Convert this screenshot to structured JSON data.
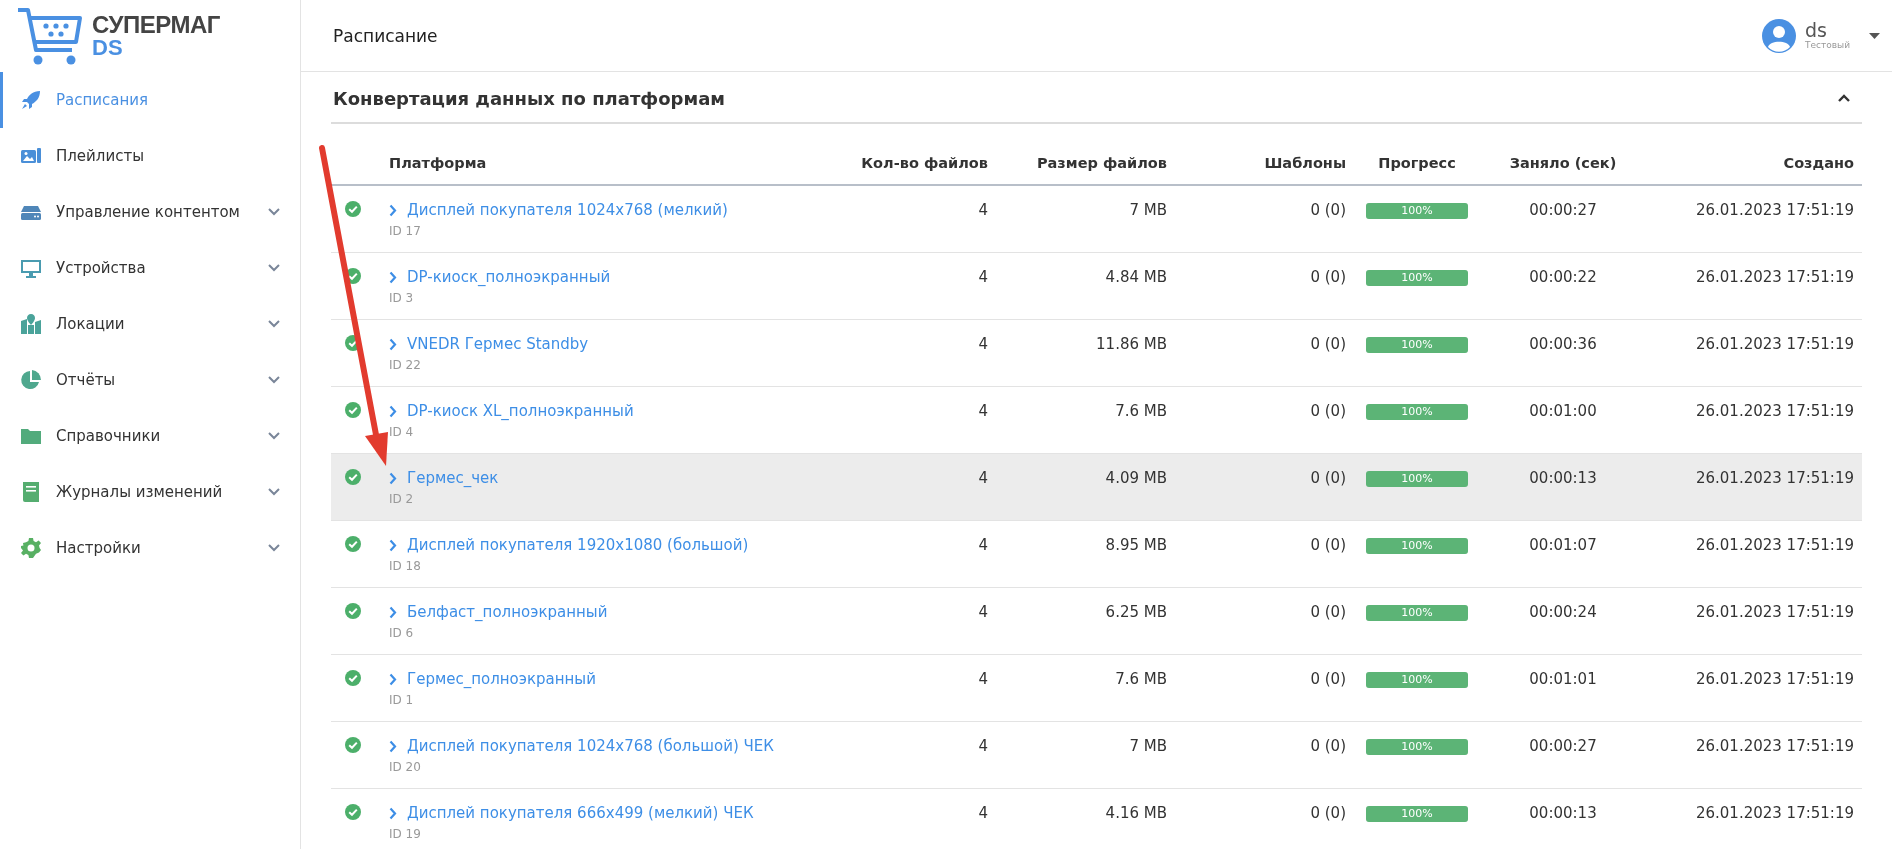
{
  "logo": {
    "line1": "СУПЕРМАГ",
    "line2": "DS"
  },
  "sidebar": {
    "items": [
      {
        "label": "Расписания",
        "selected": true,
        "expandable": false
      },
      {
        "label": "Плейлисты",
        "selected": false,
        "expandable": false
      },
      {
        "label": "Управление контентом",
        "selected": false,
        "expandable": true
      },
      {
        "label": "Устройства",
        "selected": false,
        "expandable": true
      },
      {
        "label": "Локации",
        "selected": false,
        "expandable": true
      },
      {
        "label": "Отчёты",
        "selected": false,
        "expandable": true
      },
      {
        "label": "Справочники",
        "selected": false,
        "expandable": true
      },
      {
        "label": "Журналы изменений",
        "selected": false,
        "expandable": true
      },
      {
        "label": "Настройки",
        "selected": false,
        "expandable": true
      }
    ]
  },
  "header": {
    "title": "Расписание",
    "user": {
      "name": "ds",
      "role": "Тестовый"
    }
  },
  "section": {
    "title": "Конвертация данных по платформам",
    "expanded": true
  },
  "table": {
    "columns": [
      "Платформа",
      "Кол-во файлов",
      "Размер файлов",
      "Шаблоны",
      "Прогресс",
      "Заняло (сек)",
      "Создано"
    ],
    "rows": [
      {
        "platform": "Дисплей покупателя 1024x768 (мелкий)",
        "id": "ID 17",
        "files": "4",
        "size": "7 MB",
        "templates": "0 (0)",
        "progress": "100%",
        "level": 1,
        "duration": "00:00:27",
        "created": "26.01.2023 17:51:19",
        "selected": false
      },
      {
        "platform": "DP-киоск_полноэкранный",
        "id": "ID 3",
        "files": "4",
        "size": "4.84 MB",
        "templates": "0 (0)",
        "progress": "100%",
        "level": 1,
        "duration": "00:00:22",
        "created": "26.01.2023 17:51:19",
        "selected": false
      },
      {
        "platform": "VNEDR Гермес Standby",
        "id": "ID 22",
        "files": "4",
        "size": "11.86 MB",
        "templates": "0 (0)",
        "progress": "100%",
        "level": 1,
        "duration": "00:00:36",
        "created": "26.01.2023 17:51:19",
        "selected": false
      },
      {
        "platform": "DP-киоск XL_полноэкранный",
        "id": "ID 4",
        "files": "4",
        "size": "7.6 MB",
        "templates": "0 (0)",
        "progress": "100%",
        "level": 1,
        "duration": "00:01:00",
        "created": "26.01.2023 17:51:19",
        "selected": false
      },
      {
        "platform": "Гермес_чек",
        "id": "ID 2",
        "files": "4",
        "size": "4.09 MB",
        "templates": "0 (0)",
        "progress": "100%",
        "level": 1,
        "duration": "00:00:13",
        "created": "26.01.2023 17:51:19",
        "selected": true
      },
      {
        "platform": "Дисплей покупателя 1920x1080 (большой)",
        "id": "ID 18",
        "files": "4",
        "size": "8.95 MB",
        "templates": "0 (0)",
        "progress": "100%",
        "level": 1,
        "duration": "00:01:07",
        "created": "26.01.2023 17:51:19",
        "selected": false
      },
      {
        "platform": "Белфаст_полноэкранный",
        "id": "ID 6",
        "files": "4",
        "size": "6.25 MB",
        "templates": "0 (0)",
        "progress": "100%",
        "level": 1,
        "duration": "00:00:24",
        "created": "26.01.2023 17:51:19",
        "selected": false
      },
      {
        "platform": "Гермес_полноэкранный",
        "id": "ID 1",
        "files": "4",
        "size": "7.6 MB",
        "templates": "0 (0)",
        "progress": "100%",
        "level": 1,
        "duration": "00:01:01",
        "created": "26.01.2023 17:51:19",
        "selected": false
      },
      {
        "platform": "Дисплей покупателя 1024x768 (большой) ЧЕК",
        "id": "ID 20",
        "files": "4",
        "size": "7 MB",
        "templates": "0 (0)",
        "progress": "100%",
        "level": 1,
        "duration": "00:00:27",
        "created": "26.01.2023 17:51:19",
        "selected": false
      },
      {
        "platform": "Дисплей покупателя 666x499 (мелкий) ЧЕК",
        "id": "ID 19",
        "files": "4",
        "size": "4.16 MB",
        "templates": "0 (0)",
        "progress": "100%",
        "level": 1,
        "duration": "00:00:13",
        "created": "26.01.2023 17:51:19",
        "selected": false
      }
    ]
  }
}
